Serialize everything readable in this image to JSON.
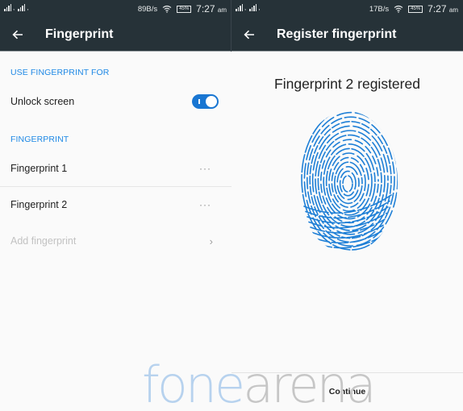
{
  "left_screen": {
    "status_bar": {
      "speed": "89B/s",
      "battery": "45%",
      "time": "7:27",
      "ampm": "am"
    },
    "toolbar": {
      "back_icon": "arrow-left-icon",
      "title": "Fingerprint"
    },
    "sections": {
      "use_for_header": "USE FINGERPRINT FOR",
      "unlock_screen_label": "Unlock screen",
      "unlock_screen_enabled": true,
      "fingerprint_header": "FINGERPRINT"
    },
    "fingerprints": [
      {
        "label": "Fingerprint 1",
        "menu": "···"
      },
      {
        "label": "Fingerprint 2",
        "menu": "···"
      }
    ],
    "add_fingerprint": {
      "label": "Add fingerprint",
      "chevron": "›"
    }
  },
  "right_screen": {
    "status_bar": {
      "speed": "17B/s",
      "battery": "45%",
      "time": "7:27",
      "ampm": "am"
    },
    "toolbar": {
      "back_icon": "arrow-left-icon",
      "title": "Register fingerprint"
    },
    "message": "Fingerprint 2 registered",
    "fingerprint_icon": "fingerprint-icon",
    "continue_label": "Continue"
  },
  "watermark": {
    "part1": "fone",
    "part2": "arena"
  },
  "colors": {
    "appbar": "#263238",
    "accent": "#1e88e5",
    "toggle": "#1976d2",
    "fingerprint": "#1e7fd6"
  }
}
